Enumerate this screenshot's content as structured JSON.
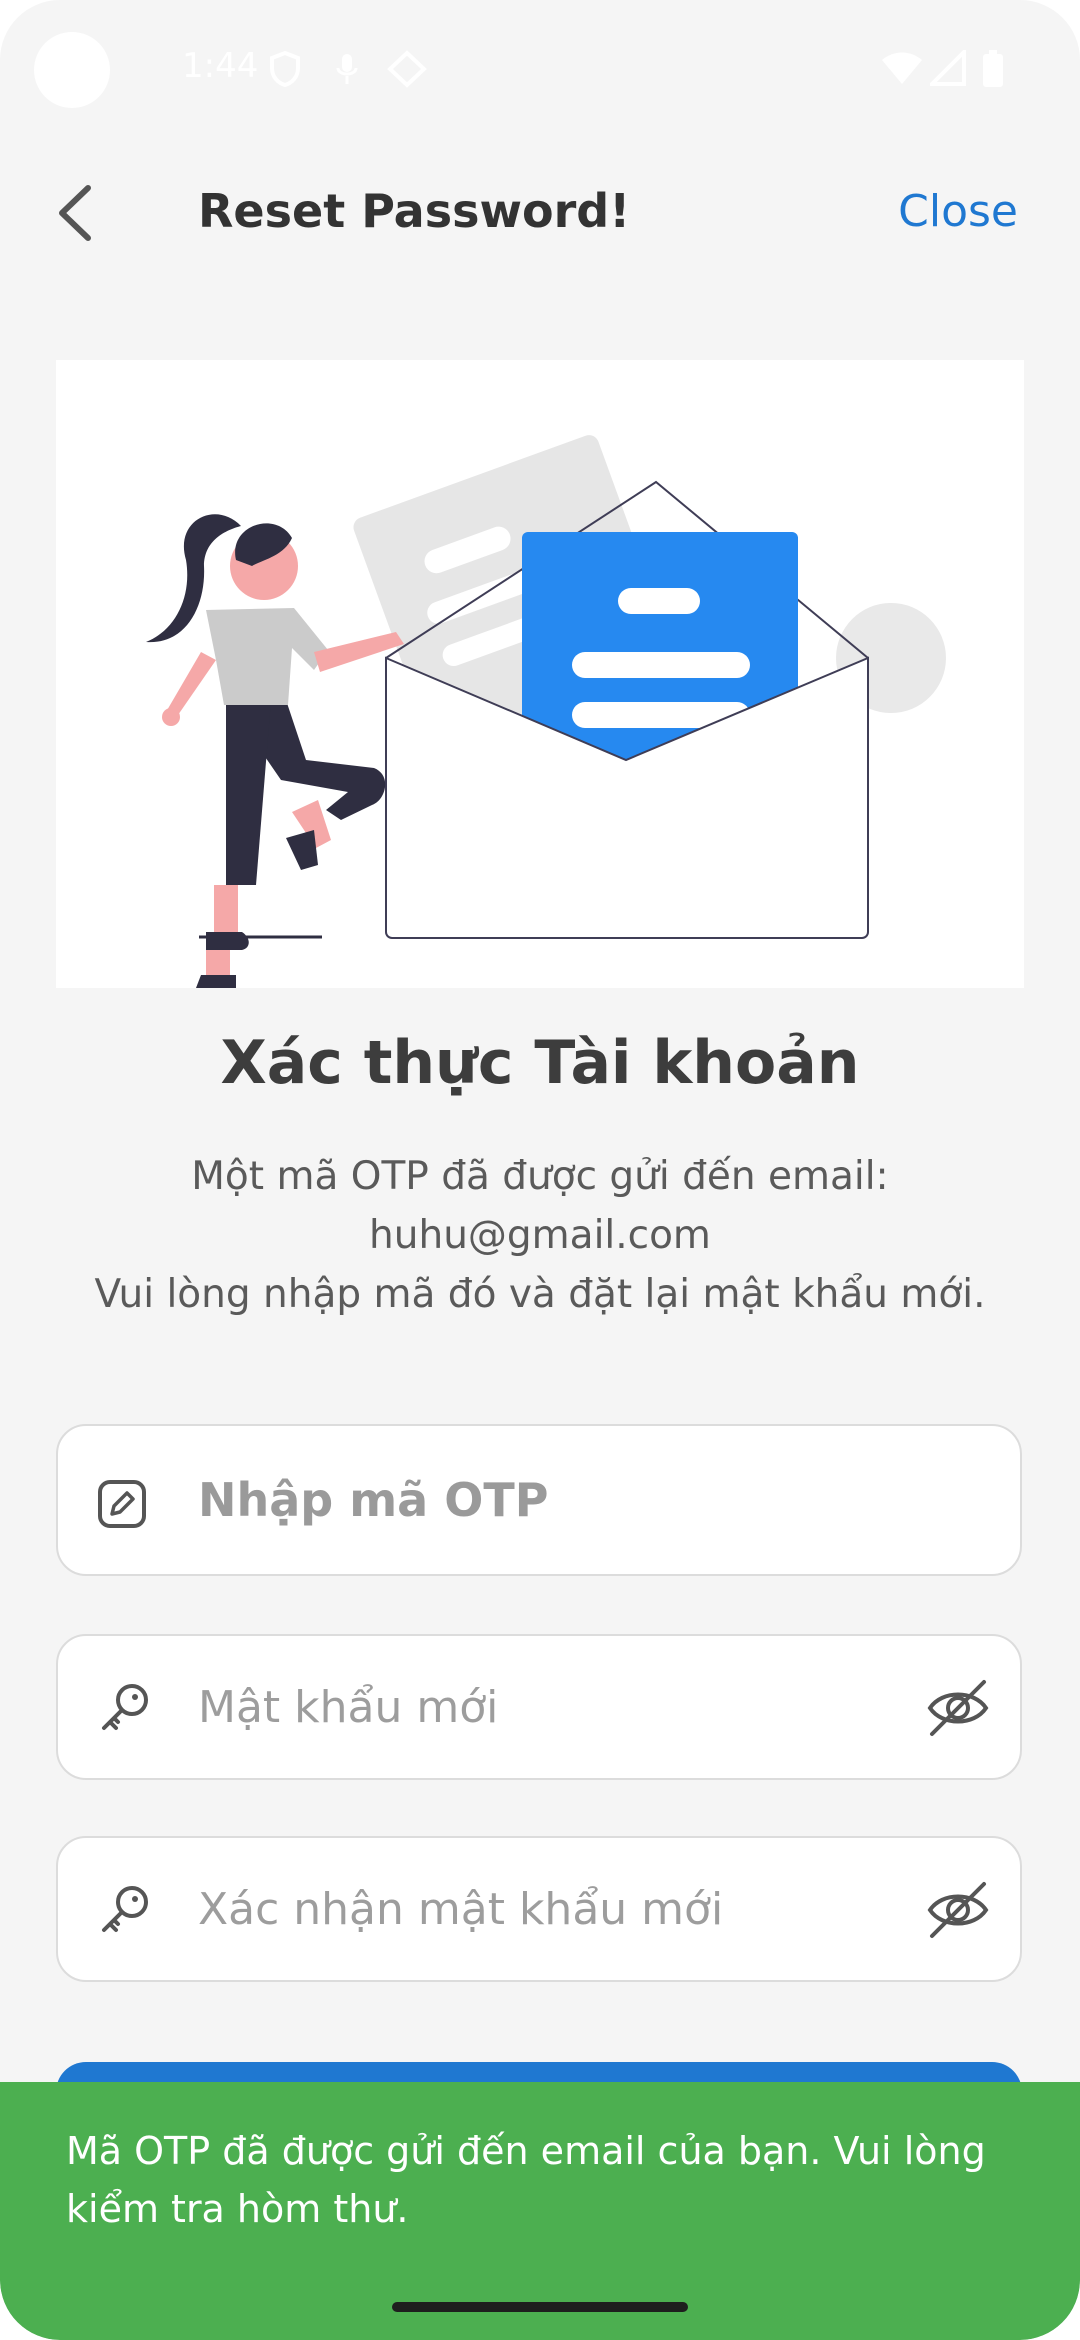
{
  "status_bar": {
    "time": "1:44"
  },
  "header": {
    "title": "Reset Password!",
    "close_label": "Close"
  },
  "content": {
    "heading": "Xác thực Tài khoản",
    "desc_line1": "Một mã OTP đã được gửi đến email:",
    "email": "huhu@gmail.com",
    "desc_line3": "Vui lòng nhập mã đó và đặt lại mật khẩu mới."
  },
  "form": {
    "otp_placeholder": "Nhập mã OTP",
    "new_password_placeholder": "Mật khẩu mới",
    "confirm_password_placeholder": "Xác nhận mật khẩu mới"
  },
  "snackbar": {
    "message": "Mã OTP đã được gửi đến email của bạn. Vui lòng kiểm tra hòm thư."
  },
  "colors": {
    "accent": "#1f78d1",
    "snackbar": "#4caf50",
    "background": "#f5f5f5"
  },
  "icons": [
    "back-arrow-icon",
    "edit-icon",
    "key-icon",
    "eye-off-icon",
    "wifi-icon",
    "signal-icon",
    "battery-icon"
  ]
}
